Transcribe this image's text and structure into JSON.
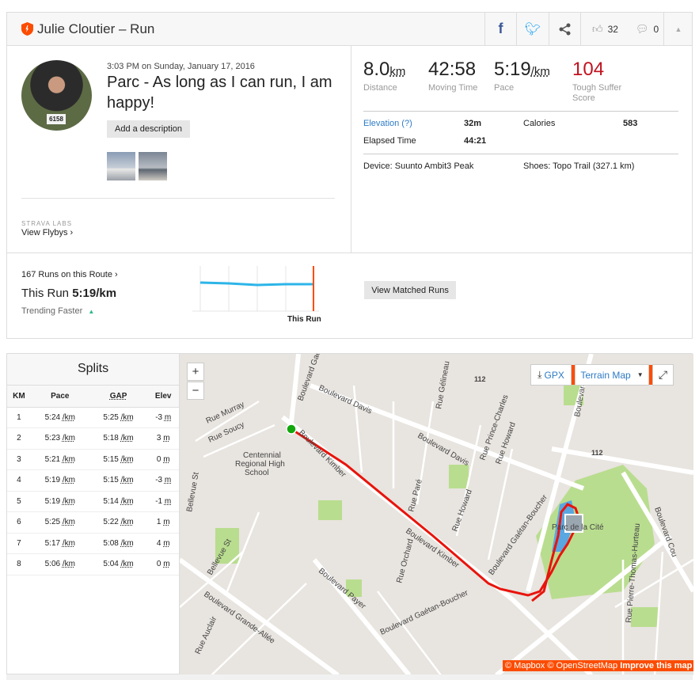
{
  "header": {
    "title": "Julie Cloutier – Run",
    "kudos_count": "32",
    "comment_count": "0",
    "icons": [
      "facebook-icon",
      "twitter-icon",
      "share-icon",
      "thumbs-up-icon",
      "comment-icon",
      "collapse-icon"
    ]
  },
  "activity": {
    "datetime": "3:03 PM on Sunday, January 17, 2016",
    "name": "Parc - As long as I can run, I am happy!",
    "add_description": "Add a description",
    "avatar_bib": "6158",
    "labs_label": "STRAVA LABS",
    "flybys_link": "View Flybys ›"
  },
  "stats": {
    "distance": {
      "value": "8.0",
      "unit": "km",
      "label": "Distance"
    },
    "moving_time": {
      "value": "42:58",
      "label": "Moving Time"
    },
    "pace": {
      "value": "5:19",
      "unit": "/km",
      "label": "Pace"
    },
    "suffer": {
      "value": "104",
      "label": "Tough Suffer Score",
      "color": "#c1121f"
    },
    "elevation_label": "Elevation (?)",
    "elevation_value": "32m",
    "calories_label": "Calories",
    "calories_value": "583",
    "elapsed_label": "Elapsed Time",
    "elapsed_value": "44:21",
    "device": "Device: Suunto Ambit3 Peak",
    "shoes": "Shoes: Topo Trail (327.1 km)"
  },
  "route": {
    "runs_link": "167 Runs on this Route ›",
    "this_run_label": "This Run",
    "this_run_pace": "5:19/km",
    "trend": "Trending Faster",
    "trend_icon": "▲",
    "chart_label": "This Run",
    "matched_button": "View Matched Runs",
    "line_color": "#2cb5e8",
    "marker_color": "#fc4c02"
  },
  "splits": {
    "title": "Splits",
    "headers": [
      "KM",
      "Pace",
      "GAP",
      "Elev"
    ],
    "rows": [
      {
        "km": "1",
        "pace": "5:24",
        "gap": "5:25",
        "elev": "-3"
      },
      {
        "km": "2",
        "pace": "5:23",
        "gap": "5:18",
        "elev": "3"
      },
      {
        "km": "3",
        "pace": "5:21",
        "gap": "5:15",
        "elev": "0"
      },
      {
        "km": "4",
        "pace": "5:19",
        "gap": "5:15",
        "elev": "-3"
      },
      {
        "km": "5",
        "pace": "5:19",
        "gap": "5:14",
        "elev": "-1"
      },
      {
        "km": "6",
        "pace": "5:25",
        "gap": "5:22",
        "elev": "1"
      },
      {
        "km": "7",
        "pace": "5:17",
        "gap": "5:08",
        "elev": "4"
      },
      {
        "km": "8",
        "pace": "5:06",
        "gap": "5:04",
        "elev": "0"
      }
    ],
    "pace_unit": "/km",
    "elev_unit": "m"
  },
  "map": {
    "zoom_in": "+",
    "zoom_out": "−",
    "gpx": "GPX",
    "map_type": "Terrain Map",
    "attribution": "© Mapbox © OpenStreetMap",
    "improve": "Improve this map",
    "labels": [
      "Boulevard Gaé",
      "Boulevard Davis",
      "Rue Gélineau",
      "Rue Prince-Charles",
      "Rue Howard",
      "Boulevard Davis",
      "Boulevard Kimber",
      "Rue Murray",
      "Rue Soucy",
      "Centennial",
      "Regional High",
      "School",
      "Rue Paré",
      "Rue Howard",
      "Rue Orchard",
      "Boulevard Kimber",
      "Boulevard Gaétan-Boucher",
      "Parc de la Cité",
      "Boulevard Cou",
      "Rue Pierre-Thomas-Hurteau",
      "Bellevue St",
      "Boulevard Payer",
      "Boulevard Grande-Allée",
      "Boulevard Gaétan-Boucher",
      "Rue Auclair",
      "Bellevue St",
      "Boulevard",
      "112",
      "112"
    ],
    "route_color": "#e8140c",
    "start_color": "#12a70c"
  }
}
